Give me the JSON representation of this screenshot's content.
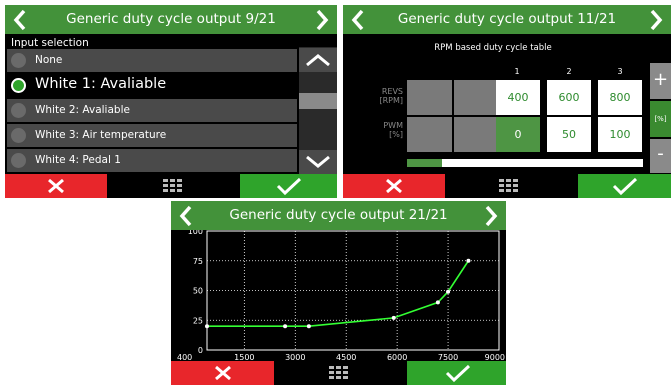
{
  "colors": {
    "header": "#43923a",
    "cancel": "#e8262b",
    "confirm": "#2fa42b",
    "panel_bg": "#000000",
    "line": "#33ff33"
  },
  "icons": {
    "prev": "chevron-left-icon",
    "next": "chevron-right-icon",
    "cancel": "x-icon",
    "menu": "grid-icon",
    "confirm": "check-icon",
    "scroll_up": "chevron-up-icon",
    "scroll_down": "chevron-down-icon"
  },
  "panel1": {
    "title": "Generic duty cycle output 9/21",
    "section_label": "Input selection",
    "items": [
      {
        "label": "None",
        "selected": false
      },
      {
        "label": "White 1: Avaliable",
        "selected": true
      },
      {
        "label": "White 2: Avaliable",
        "selected": false
      },
      {
        "label": "White 3: Air temperature",
        "selected": false
      },
      {
        "label": "White 4: Pedal 1",
        "selected": false
      }
    ]
  },
  "panel2": {
    "title": "Generic duty cycle output 11/21",
    "table_title": "RPM based duty cycle table",
    "columns": [
      "1",
      "2",
      "3"
    ],
    "rows": [
      {
        "label_line1": "REVS",
        "label_line2": "[RPM]",
        "values": [
          "400",
          "600",
          "800"
        ]
      },
      {
        "label_line1": "PWM",
        "label_line2": "[%]",
        "values": [
          "0",
          "50",
          "100"
        ]
      }
    ],
    "active_cell": "0",
    "side_plus": "+",
    "side_unit": "[%]",
    "side_minus": "-",
    "scroll_progress": 0.15
  },
  "panel3": {
    "title": "Generic duty cycle output 21/21"
  },
  "chart_data": {
    "type": "line",
    "xlim": [
      400,
      9000
    ],
    "ylim": [
      0,
      100
    ],
    "x_ticks": [
      "400",
      "1500",
      "3000",
      "4500",
      "6000",
      "7500",
      "9000"
    ],
    "y_ticks": [
      "0",
      "25",
      "50",
      "75",
      "100"
    ],
    "grid": true,
    "series": [
      {
        "x": [
          400,
          2700,
          3400,
          5900,
          7200,
          7500,
          8100
        ],
        "y": [
          20,
          20,
          20,
          27,
          40,
          49,
          75
        ]
      }
    ]
  }
}
